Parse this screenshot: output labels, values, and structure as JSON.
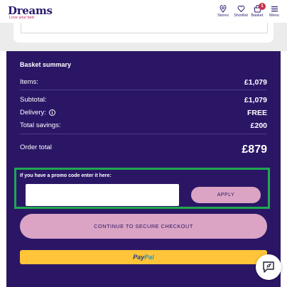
{
  "header": {
    "logo": "Dreams",
    "tagline": "Love your bed",
    "nav": [
      {
        "label": "Stores",
        "icon": "location-pin-icon"
      },
      {
        "label": "Shortlist",
        "icon": "heart-icon"
      },
      {
        "label": "Basket",
        "icon": "basket-icon",
        "badge": "1"
      },
      {
        "label": "Menu",
        "icon": "hamburger-icon"
      }
    ]
  },
  "summary": {
    "title": "Basket summary",
    "items_label": "Items:",
    "items_value": "£1,079",
    "subtotal_label": "Subtotal:",
    "subtotal_value": "£1,079",
    "delivery_label": "Delivery:",
    "delivery_value": "FREE",
    "savings_label": "Total savings:",
    "savings_value": "£200",
    "total_label": "Order total",
    "total_value": "£879"
  },
  "promo": {
    "label": "If you have a promo code enter it here:",
    "input_value": "",
    "input_placeholder": "",
    "apply_label": "APPLY"
  },
  "checkout": {
    "label": "CONTINUE TO SECURE CHECKOUT"
  },
  "paypal": {
    "part1": "Pay",
    "part2": "Pal"
  },
  "colors": {
    "panel": "#2b1666",
    "button_pink": "#dba4c4",
    "paypal_yellow": "#ffc439",
    "highlight_green": "#1fa84f"
  }
}
